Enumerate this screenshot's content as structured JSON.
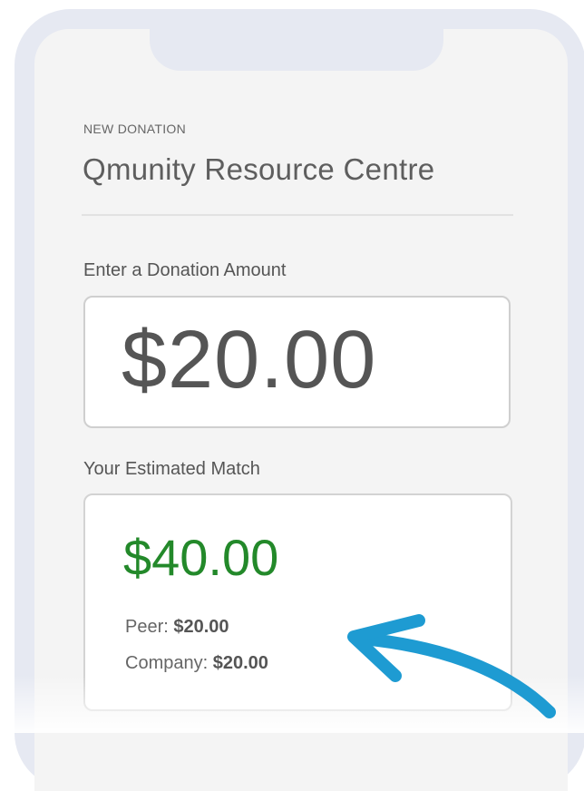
{
  "donation": {
    "eyebrow": "NEW DONATION",
    "organization": "Qmunity Resource Centre",
    "amount_label": "Enter a Donation Amount",
    "amount_value": "$20.00",
    "match_label": "Your Estimated Match",
    "match_total": "$40.00",
    "peer_label": "Peer:",
    "peer_value": "$20.00",
    "company_label": "Company:",
    "company_value": "$20.00"
  },
  "colors": {
    "match_green": "#23892a",
    "arrow_blue": "#1e9bd2",
    "frame": "#e6e9f2"
  },
  "icons": [
    "annotation-arrow-icon"
  ]
}
